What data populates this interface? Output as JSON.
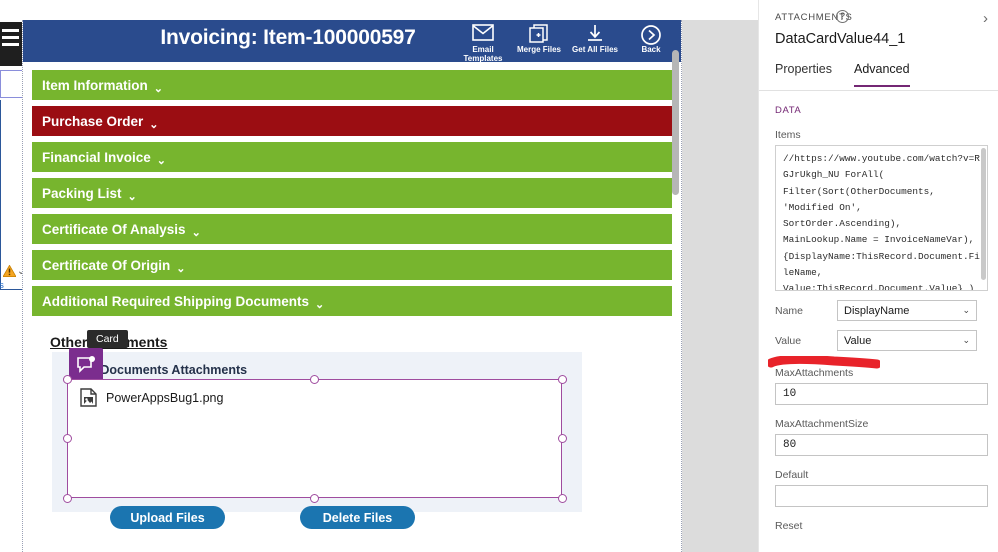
{
  "left_tree": {
    "hamburger_icon": "hamburger-menu-icon",
    "hamburger_label": "eps",
    "warning_icon": "warning-triangle-icon",
    "chevron_icon": "chevron-down-icon",
    "truncated_link": "ments"
  },
  "app": {
    "title": "Invoicing: Item-100000597",
    "header_actions": [
      {
        "label": "Email Templates",
        "icon": "envelope-icon"
      },
      {
        "label": "Merge Files",
        "icon": "merge-pages-plus-icon"
      },
      {
        "label": "Get All Files",
        "icon": "download-arrow-icon"
      },
      {
        "label": "Back",
        "icon": "circled-chevron-right-icon"
      }
    ],
    "sections": [
      {
        "label": "Item Information",
        "color": "green"
      },
      {
        "label": "Purchase Order",
        "color": "red"
      },
      {
        "label": "Financial Invoice",
        "color": "green"
      },
      {
        "label": "Packing List",
        "color": "green"
      },
      {
        "label": "Certificate Of Analysis",
        "color": "green"
      },
      {
        "label": "Certificate Of Origin",
        "color": "green"
      },
      {
        "label": "Additional Required Shipping Documents",
        "color": "green"
      }
    ],
    "other_documents": {
      "heading": "Other Documents",
      "tooltip": "Card",
      "comment_icon": "comment-badge-icon",
      "attachments_label": "r Documents Attachments",
      "file": {
        "name": "PowerAppsBug1.png",
        "icon": "image-file-icon"
      },
      "upload_button": "Upload Files",
      "delete_button": "Delete Files"
    },
    "colors": {
      "header_blue": "#2a4b8d",
      "section_green": "#77b52e",
      "section_red": "#9b0d12",
      "button_blue": "#1b75b0",
      "selection_purple": "#9f4c9f"
    }
  },
  "panel": {
    "kicker": "ATTACHMENTS",
    "help_icon": "help-question-icon",
    "expand_icon": "chevron-right-icon",
    "control_name": "DataCardValue44_1",
    "tabs": [
      {
        "label": "Properties",
        "active": false
      },
      {
        "label": "Advanced",
        "active": true
      }
    ],
    "group_label": "DATA",
    "items_label": "Items",
    "items_formula": "//https://www.youtube.com/watch?v=RGJrUkgh_NU ForAll(\nFilter(Sort(OtherDocuments,\n'Modified On',\nSortOrder.Ascending),\nMainLookup.Name = InvoiceNameVar),\n{DisplayName:ThisRecord.Document.FileName,\nValue:ThisRecord.Document.Value} )\n/*",
    "fields": [
      {
        "label": "Name",
        "value": "DisplayName",
        "type": "select"
      },
      {
        "label": "Value",
        "value": "Value",
        "type": "select"
      }
    ],
    "inputs": [
      {
        "label": "MaxAttachments",
        "value": "10"
      },
      {
        "label": "MaxAttachmentSize",
        "value": "80"
      },
      {
        "label": "Default",
        "value": ""
      }
    ],
    "reset_label": "Reset",
    "annotation": {
      "type": "red-marker-stroke",
      "color": "#e8232a"
    }
  }
}
